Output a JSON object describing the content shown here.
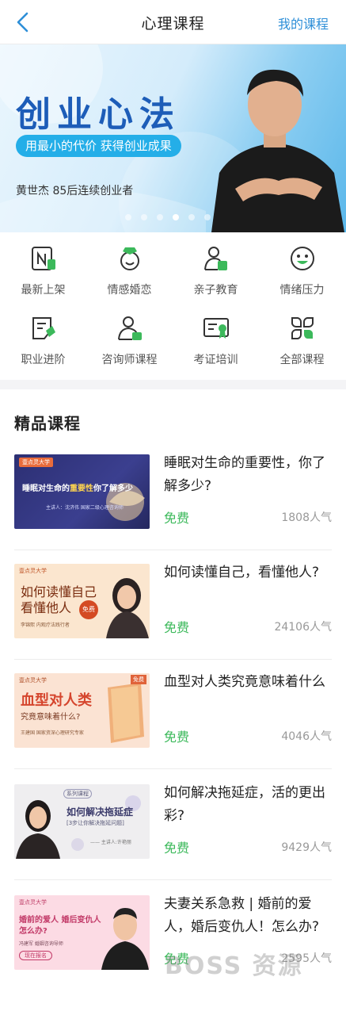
{
  "navbar": {
    "title": "心理课程",
    "right_link": "我的课程"
  },
  "banner": {
    "title": "创业心法",
    "subtitle": "用最小的代价 获得创业成果",
    "person_label": "黄世杰  85后连续创业者",
    "slide_count": 6,
    "active_slide": 3
  },
  "categories": [
    {
      "label": "最新上架",
      "icon": "new-icon"
    },
    {
      "label": "情感婚恋",
      "icon": "ring-icon"
    },
    {
      "label": "亲子教育",
      "icon": "parent-child-icon"
    },
    {
      "label": "情绪压力",
      "icon": "smile-icon"
    },
    {
      "label": "职业进阶",
      "icon": "career-icon"
    },
    {
      "label": "咨询师课程",
      "icon": "counselor-icon"
    },
    {
      "label": "考证培训",
      "icon": "certificate-icon"
    },
    {
      "label": "全部课程",
      "icon": "all-grid-icon"
    }
  ],
  "section": {
    "title": "精品课程"
  },
  "courses": [
    {
      "title": "睡眠对生命的重要性，你了解多少?",
      "price": "免费",
      "views": "1808人气",
      "thumb": {
        "tag": "壹点灵大学",
        "headline_a": "睡眠对生命的",
        "headline_b": "重要性",
        "headline_c": "你了解多少",
        "speaker": "主讲人：沈济伟  国家二级心理咨询师"
      }
    },
    {
      "title": "如何读懂自己，看懂他人?",
      "price": "免费",
      "views": "24106人气",
      "thumb": {
        "tag": "壹点灵大学",
        "headline_a": "如何读懂自己",
        "headline_b": "看懂他人",
        "badge": "免费",
        "speaker": "李锦熙  内观疗法践行者"
      }
    },
    {
      "title": "血型对人类究竟意味着什么",
      "price": "免费",
      "views": "4046人气",
      "thumb": {
        "tag": "壹点灵大学",
        "headline_a": "血型对人类",
        "headline_b": "究竟意味着什么?",
        "badge": "免费",
        "speaker": "王建国  国家资深心理研究专家"
      }
    },
    {
      "title": "如何解决拖延症，活的更出彩?",
      "price": "免费",
      "views": "9429人气",
      "thumb": {
        "tag": "系列课程",
        "headline_a": "如何解决拖延症",
        "headline_b": "[3步让你解决拖延问题]",
        "speaker": "—— 主讲人:许艳丽"
      }
    },
    {
      "title": "夫妻关系急救 | 婚前的爱人，婚后变仇人！怎么办?",
      "price": "免费",
      "views": "2595人气",
      "thumb": {
        "tag": "壹点灵大学",
        "headline_a": "婚前的爱人 婚后变仇人",
        "headline_b": "怎么办?",
        "speaker": "冯建军  婚姻咨询导师",
        "cta": "现在报名"
      }
    }
  ],
  "watermark": "BOSS 资源",
  "colors": {
    "accent": "#2e8fd8",
    "green": "#3cb95b",
    "banner_blue": "#1d5db8"
  }
}
